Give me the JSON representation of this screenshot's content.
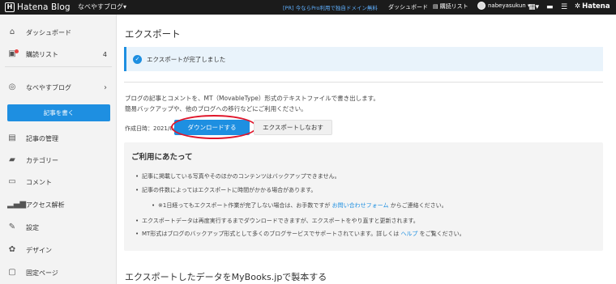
{
  "topbar": {
    "logo_mark": "H",
    "logo_text": "Hatena Blog",
    "blog_name": "なべやすブログ▾",
    "pr_text": "[PR] 今ならPro利用で独自ドメイン無料",
    "dashboard": "ダッシュボード",
    "reading_list": "購読リスト",
    "username": "nabeyasukun ▾",
    "hatena": "Hatena"
  },
  "sidebar": {
    "items": [
      {
        "label": "ダッシュボード",
        "icon": "home-icon"
      },
      {
        "label": "購読リスト",
        "icon": "reading-list-icon",
        "count": "4"
      },
      {
        "label": "なべやすブログ",
        "icon": "blog-icon"
      },
      {
        "label": "記事の管理",
        "icon": "articles-icon"
      },
      {
        "label": "カテゴリー",
        "icon": "folder-icon"
      },
      {
        "label": "コメント",
        "icon": "comment-icon"
      },
      {
        "label": "アクセス解析",
        "icon": "chart-icon"
      },
      {
        "label": "設定",
        "icon": "wrench-icon"
      },
      {
        "label": "デザイン",
        "icon": "palette-icon"
      },
      {
        "label": "固定ページ",
        "icon": "page-icon"
      }
    ],
    "write_button": "記事を書く"
  },
  "main": {
    "title": "エクスポート",
    "alert": "エクスポートが完了しました",
    "desc_line1": "ブログの記事とコメントを、MT（MovableType）形式のテキストファイルで書き出します。",
    "desc_line2": "簡易バックアップや、他のブログへの移行などにご利用ください。",
    "created_label": "作成日時：2021/8/31",
    "download_button": "ダウンロードする",
    "reexport_button": "エクスポートしなおす",
    "notice": {
      "heading": "ご利用にあたって",
      "item1": "記事に掲載している写真やそのほかのコンテンツはバックアップできません。",
      "item2": "記事の件数によってはエクスポートに時間がかかる場合があります。",
      "item3_prefix": "※1日経ってもエクスポート作業が完了しない場合は、お手数ですが",
      "item3_link": "お問い合わせフォーム",
      "item3_suffix": "からご連絡ください。",
      "item4": "エクスポートデータは再度実行するまでダウンロードできますが、エクスポートをやり直すと更新されます。",
      "item5_prefix": "MT形式はブログのバックアップ形式として多くのブログサービスでサポートされています。詳しくは",
      "item5_link": "ヘルプ",
      "item5_suffix": "をご覧ください。"
    },
    "bottom_title": "エクスポートしたデータをMyBooks.jpで製本する"
  },
  "colors": {
    "accent": "#1e8fe1",
    "topbar": "#1b1b1b",
    "highlight_ring": "#e0162b"
  }
}
